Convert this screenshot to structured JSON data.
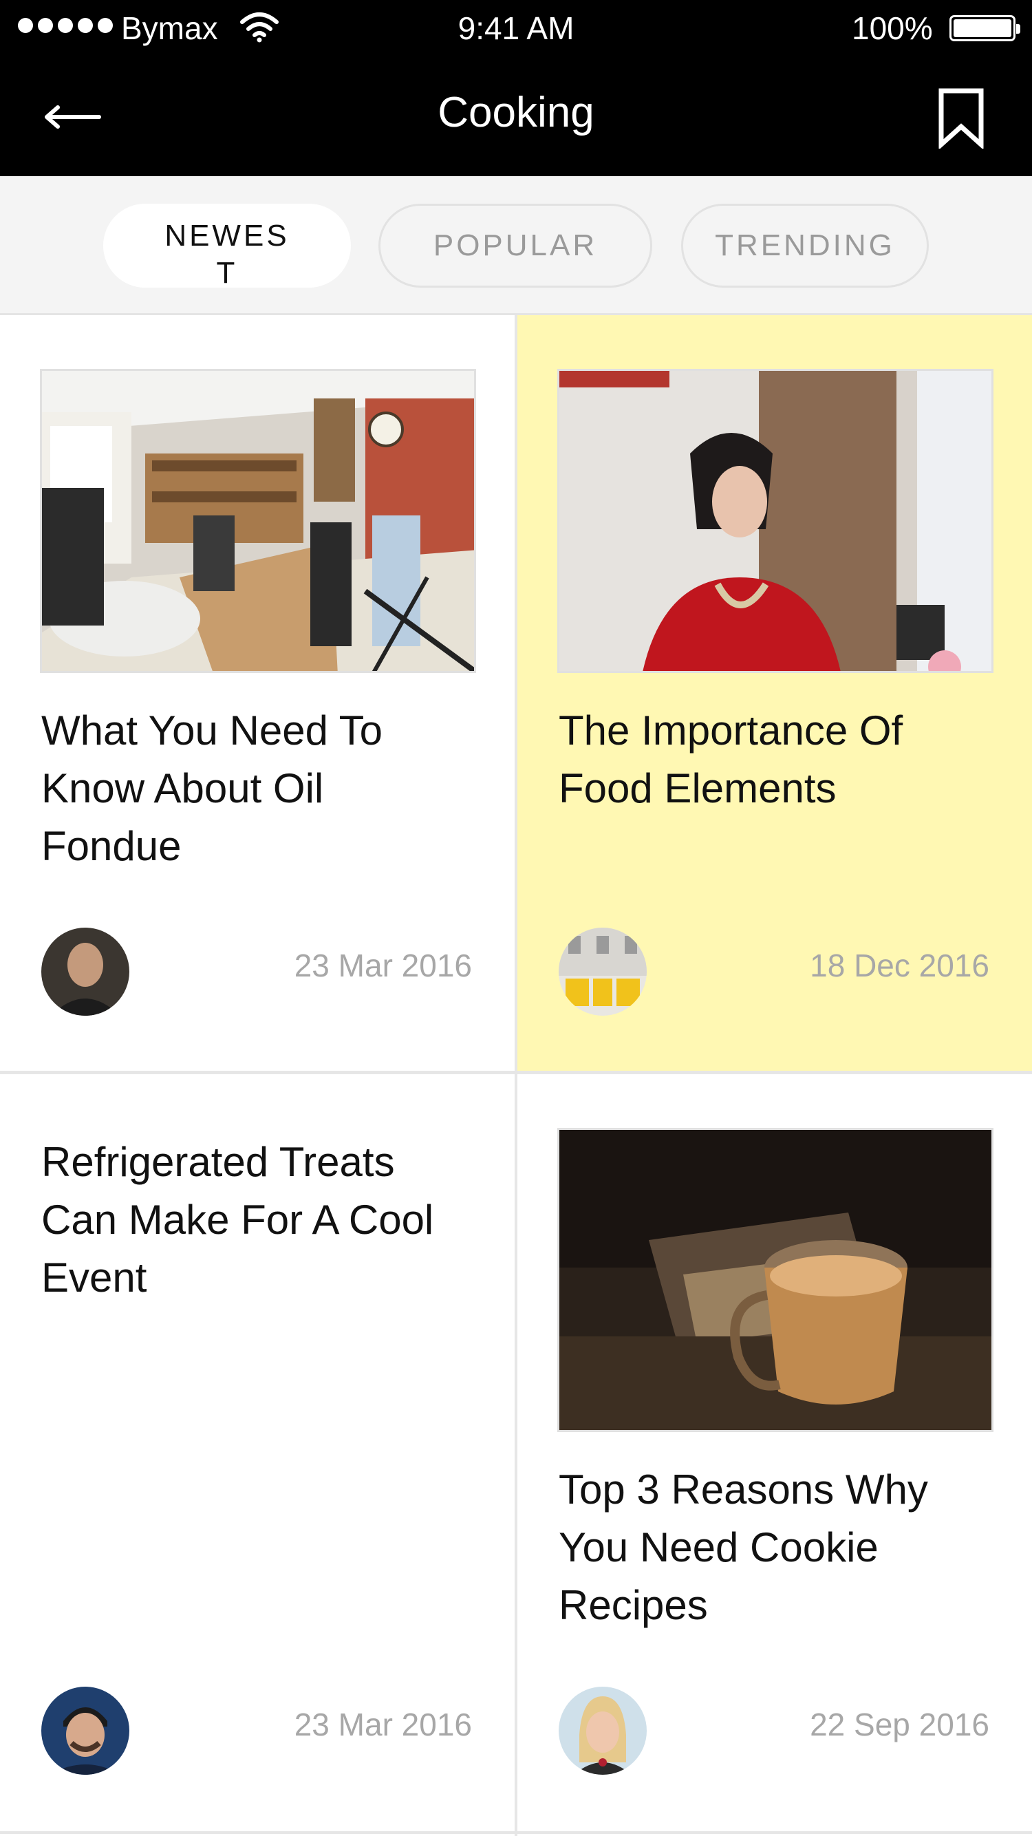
{
  "status_bar": {
    "carrier": "Bymax",
    "time": "9:41 AM",
    "battery": "100%"
  },
  "header": {
    "title": "Cooking",
    "back_icon": "arrow-left-icon",
    "bookmark_icon": "bookmark-icon"
  },
  "tabs": [
    {
      "label": "NEWEST",
      "active": true
    },
    {
      "label": "POPULAR",
      "active": false
    },
    {
      "label": "TRENDING",
      "active": false
    }
  ],
  "articles": [
    {
      "title": "What You Need To Know About Oil Fondue",
      "date": "23 Mar 2016",
      "highlighted": false,
      "image": "cafe-photo"
    },
    {
      "title": "The Importance Of Food Elements",
      "date": "18 Dec 2016",
      "highlighted": true,
      "image": "woman-portrait-photo"
    },
    {
      "title": "Refrigerated Treats Can Make For A Cool Event",
      "date": "23 Mar 2016",
      "highlighted": false,
      "image": null
    },
    {
      "title": "Top 3 Reasons Why You Need Cookie Recipes",
      "date": "22 Sep 2016",
      "highlighted": false,
      "image": "coffee-cup-photo"
    }
  ],
  "colors": {
    "header_bg": "#000000",
    "highlight_bg": "#fff8b3",
    "date_text": "#a7a7a7"
  }
}
